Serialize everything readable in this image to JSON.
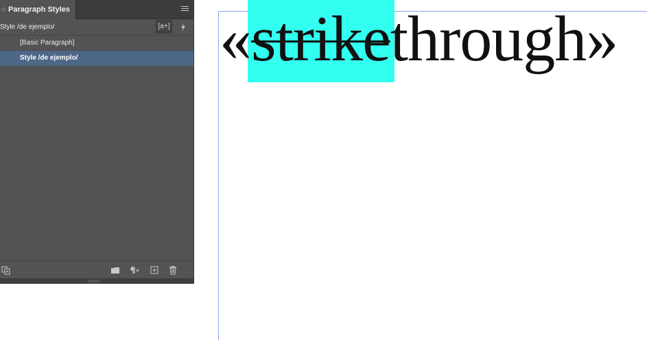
{
  "panel": {
    "title": "Paragraph Styles",
    "current_style": "Style /de ejemplo/",
    "new_style_button": "[a+]",
    "styles": [
      {
        "label": "[Basic Paragraph]",
        "selected": false
      },
      {
        "label": "Style /de ejemplo/",
        "selected": true
      }
    ],
    "icons": {
      "collapse": "collapse-arrows-icon",
      "menu": "panel-menu-icon",
      "lightning": "lightning-icon",
      "bottom_left": "style-mapping-icon",
      "folder": "new-group-folder-icon",
      "clear_overrides": "clear-overrides-icon",
      "new_style": "create-new-style-icon",
      "delete": "trash-icon"
    }
  },
  "document": {
    "open_quote": "«",
    "struck_text": "strike",
    "plain_text": "through",
    "close_quote": "»",
    "highlight_color": "#33fff0",
    "margin_guide_color": "#8aa6e8"
  }
}
